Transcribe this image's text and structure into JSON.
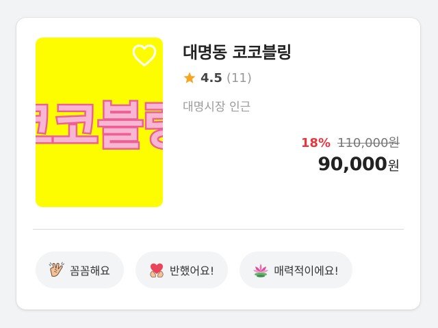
{
  "product": {
    "name": "대명동 코코블링",
    "rating": "4.5",
    "review_count": "(11)",
    "location": "대명시장 인근",
    "thumbnail_text": "코코블링",
    "discount": "18%",
    "original_price": "110,000원",
    "price": "90,000",
    "price_unit": "원"
  },
  "tags": [
    {
      "label": "꼼꼼해요",
      "icon": "clapping-hands-icon"
    },
    {
      "label": "반했어요!",
      "icon": "heart-hands-icon"
    },
    {
      "label": "매력적이에요!",
      "icon": "lotus-flower-icon"
    }
  ],
  "colors": {
    "thumbnail_bg": "#fdfd00",
    "thumbnail_text": "#f7b7d2",
    "thumbnail_stroke": "#ee5f93",
    "discount": "#e8363f",
    "star": "#f5a623"
  }
}
